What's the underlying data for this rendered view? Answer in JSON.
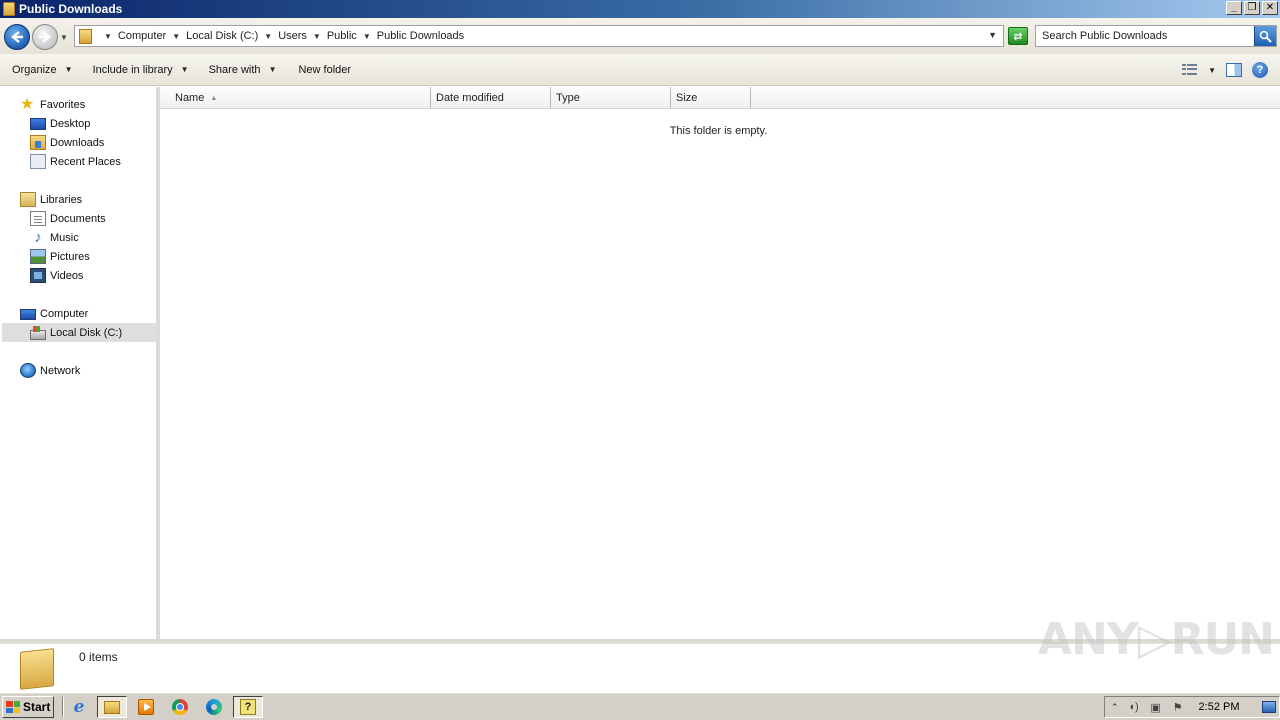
{
  "window": {
    "title": "Public Downloads",
    "controls": {
      "minimize": "_",
      "restore": "❐",
      "close": "✕"
    }
  },
  "address_bar": {
    "breadcrumbs": [
      "Computer",
      "Local Disk (C:)",
      "Users",
      "Public",
      "Public Downloads"
    ],
    "search_placeholder": "Search Public Downloads"
  },
  "toolbar": {
    "organize": "Organize",
    "include_in_library": "Include in library",
    "share_with": "Share with",
    "new_folder": "New folder"
  },
  "nav_pane": {
    "favorites": {
      "label": "Favorites",
      "items": [
        "Desktop",
        "Downloads",
        "Recent Places"
      ]
    },
    "libraries": {
      "label": "Libraries",
      "items": [
        "Documents",
        "Music",
        "Pictures",
        "Videos"
      ]
    },
    "computer": {
      "label": "Computer",
      "items": [
        "Local Disk (C:)"
      ],
      "selected": "Local Disk (C:)"
    },
    "network": {
      "label": "Network"
    }
  },
  "file_list": {
    "columns": [
      "Name",
      "Date modified",
      "Type",
      "Size"
    ],
    "sort_column": "Name",
    "empty_message": "This folder is empty."
  },
  "details_pane": {
    "item_count": "0 items"
  },
  "watermark": "ANY▷RUN",
  "taskbar": {
    "start_label": "Start",
    "pinned_icons": [
      "internet-explorer-icon",
      "windows-explorer-icon",
      "media-player-icon",
      "chrome-icon",
      "edge-icon",
      "help-icon"
    ],
    "clock": "2:52 PM"
  },
  "colors": {
    "accent": "#0a246a",
    "taskbar": "#d4d0c8",
    "selection": "#dedede"
  }
}
